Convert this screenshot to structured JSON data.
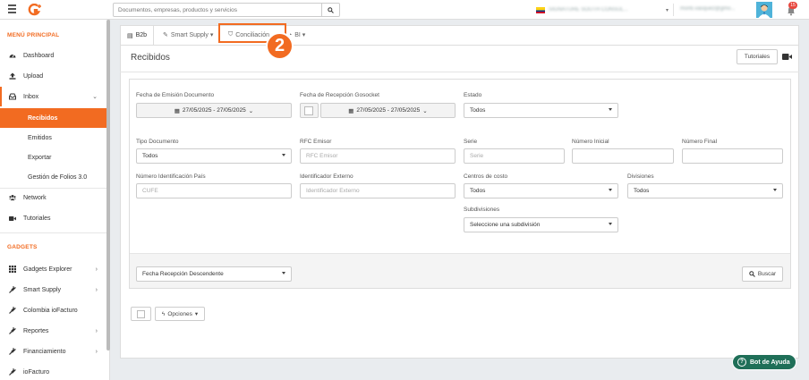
{
  "topbar": {
    "search_placeholder": "Documentos, empresas, productos y servicios",
    "company_name": "SIGNATURE SOUTH CONSUL...",
    "user_email": "monti.vasquez@gmo...",
    "notification_count": "15"
  },
  "sidebar": {
    "menu_title": "MENÚ PRINCIPAL",
    "items": [
      {
        "label": "Dashboard",
        "icon": "dashboard-icon"
      },
      {
        "label": "Upload",
        "icon": "upload-icon"
      },
      {
        "label": "Inbox",
        "icon": "inbox-icon"
      },
      {
        "label": "Recibidos"
      },
      {
        "label": "Emitidos"
      },
      {
        "label": "Exportar"
      },
      {
        "label": "Gestión de Folios 3.0"
      },
      {
        "label": "Network",
        "icon": "network-icon"
      },
      {
        "label": "Tutoriales",
        "icon": "video-icon"
      }
    ],
    "gadgets_title": "GADGETS",
    "gadgets": [
      {
        "label": "Gadgets Explorer"
      },
      {
        "label": "Smart Supply"
      },
      {
        "label": "Colombia ioFacturo"
      },
      {
        "label": "Reportes"
      },
      {
        "label": "Financiamiento"
      },
      {
        "label": "ioFacturo"
      }
    ]
  },
  "tabs": [
    {
      "label": "B2b"
    },
    {
      "label": "Smart Supply ▾"
    },
    {
      "label": "Conciliación"
    },
    {
      "label": "BI ▾"
    }
  ],
  "annotation": {
    "step": "2"
  },
  "page": {
    "title": "Recibidos",
    "tutorials_label": "Tutoriales"
  },
  "filters": {
    "fecha_emision_label": "Fecha de Emisión Documento",
    "fecha_emision_value": "27/05/2025 - 27/05/2025",
    "fecha_recepcion_label": "Fecha de Recepción Gosocket",
    "fecha_recepcion_value": "27/05/2025 - 27/05/2025",
    "estado_label": "Estado",
    "estado_value": "Todos",
    "tipo_doc_label": "Tipo Documento",
    "tipo_doc_value": "Todos",
    "rfc_label": "RFC Emisor",
    "rfc_placeholder": "RFC Emisor",
    "serie_label": "Serie",
    "serie_placeholder": "Serie",
    "num_inicial_label": "Número Inicial",
    "num_final_label": "Número Final",
    "num_ident_label": "Número Identificación País",
    "num_ident_placeholder": "CUFE",
    "id_externo_label": "Identificador Externo",
    "id_externo_placeholder": "Identificador Externo",
    "centros_label": "Centros de costo",
    "centros_value": "Todos",
    "divisiones_label": "Divisiones",
    "divisiones_value": "Todos",
    "subdiv_label": "Subdivisiones",
    "subdiv_value": "Seleccione una subdivisión",
    "sort_value": "Fecha Recepción Descendente",
    "search_label": "Buscar"
  },
  "actions": {
    "options_label": "Opciones"
  },
  "bot": {
    "label": "Bot de Ayuda"
  }
}
